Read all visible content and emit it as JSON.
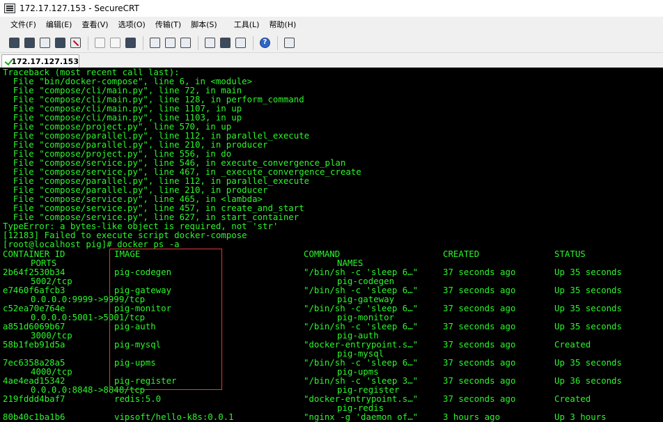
{
  "window": {
    "title": "172.17.127.153 - SecureCRT"
  },
  "menu": [
    "文件(F)",
    "编辑(E)",
    "查看(V)",
    "选项(O)",
    "传输(T)",
    "脚本(S)",
    "工具(L)",
    "帮助(H)"
  ],
  "toolbar": {
    "icons": [
      "connect-icon",
      "quick-connect-icon",
      "connect-tab-icon",
      "reconnect-icon",
      "disconnect-icon",
      "copy-icon",
      "paste-icon",
      "find-icon",
      "print-icon",
      "print-setup-icon",
      "print-screen-icon",
      "session-options-icon",
      "global-options-icon",
      "keymap-icon",
      "help-icon",
      "about-icon"
    ]
  },
  "tab": {
    "label": "172.17.127.153"
  },
  "terminal": {
    "text_color": "#2bf52b",
    "background": "#000000",
    "traceback_lines": [
      "Traceback (most recent call last):",
      "  File \"bin/docker-compose\", line 6, in <module>",
      "  File \"compose/cli/main.py\", line 72, in main",
      "  File \"compose/cli/main.py\", line 128, in perform_command",
      "  File \"compose/cli/main.py\", line 1107, in up",
      "  File \"compose/cli/main.py\", line 1103, in up",
      "  File \"compose/project.py\", line 570, in up",
      "  File \"compose/parallel.py\", line 112, in parallel_execute",
      "  File \"compose/parallel.py\", line 210, in producer",
      "  File \"compose/project.py\", line 556, in do",
      "  File \"compose/service.py\", line 546, in execute_convergence_plan",
      "  File \"compose/service.py\", line 467, in _execute_convergence_create",
      "  File \"compose/parallel.py\", line 112, in parallel_execute",
      "  File \"compose/parallel.py\", line 210, in producer",
      "  File \"compose/service.py\", line 465, in <lambda>",
      "  File \"compose/service.py\", line 457, in create_and_start",
      "  File \"compose/service.py\", line 627, in start_container",
      "TypeError: a bytes-like object is required, not 'str'",
      "[12183] Failed to execute script docker-compose",
      "[root@localhost pig]# docker ps -a"
    ],
    "ps_headers": {
      "container_id": "CONTAINER ID",
      "image": "IMAGE",
      "command": "COMMAND",
      "created": "CREATED",
      "status": "STATUS",
      "ports": "PORTS",
      "names": "NAMES"
    },
    "containers": [
      {
        "id": "2b64f2530b34",
        "image": "pig-codegen",
        "command": "\"/bin/sh -c 'sleep 6…\"",
        "created": "37 seconds ago",
        "status": "Up 35 seconds",
        "ports": "5002/tcp",
        "name": "pig-codegen"
      },
      {
        "id": "e7460f6afcb3",
        "image": "pig-gateway",
        "command": "\"/bin/sh -c 'sleep 6…\"",
        "created": "37 seconds ago",
        "status": "Up 35 seconds",
        "ports": "0.0.0.0:9999->9999/tcp",
        "name": "pig-gateway"
      },
      {
        "id": "c52ea70e764e",
        "image": "pig-monitor",
        "command": "\"/bin/sh -c 'sleep 6…\"",
        "created": "37 seconds ago",
        "status": "Up 35 seconds",
        "ports": "0.0.0.0:5001->5001/tcp",
        "name": "pig-monitor"
      },
      {
        "id": "a851d6069b67",
        "image": "pig-auth",
        "command": "\"/bin/sh -c 'sleep 6…\"",
        "created": "37 seconds ago",
        "status": "Up 35 seconds",
        "ports": "3000/tcp",
        "name": "pig-auth"
      },
      {
        "id": "58b1feb91d5a",
        "image": "pig-mysql",
        "command": "\"docker-entrypoint.s…\"",
        "created": "37 seconds ago",
        "status": "Created",
        "ports": "",
        "name": "pig-mysql"
      },
      {
        "id": "7ec6358a28a5",
        "image": "pig-upms",
        "command": "\"/bin/sh -c 'sleep 6…\"",
        "created": "37 seconds ago",
        "status": "Up 35 seconds",
        "ports": "4000/tcp",
        "name": "pig-upms"
      },
      {
        "id": "4ae4ead15342",
        "image": "pig-register",
        "command": "\"/bin/sh -c 'sleep 3…\"",
        "created": "37 seconds ago",
        "status": "Up 36 seconds",
        "ports": "0.0.0.0:8848->8848/tcp",
        "name": "pig-register"
      },
      {
        "id": "219fddd4baf7",
        "image": "redis:5.0",
        "command": "\"docker-entrypoint.s…\"",
        "created": "37 seconds ago",
        "status": "Created",
        "ports": "",
        "name": "pig-redis"
      },
      {
        "id": "80b40c1ba1b6",
        "image": "vipsoft/hello-k8s:0.0.1",
        "command": "\"nginx -g 'daemon of…\"",
        "created": "3 hours ago",
        "status": "Up 3 hours",
        "ports": "",
        "name": ""
      }
    ],
    "annotation_color": "#e23b3b"
  }
}
